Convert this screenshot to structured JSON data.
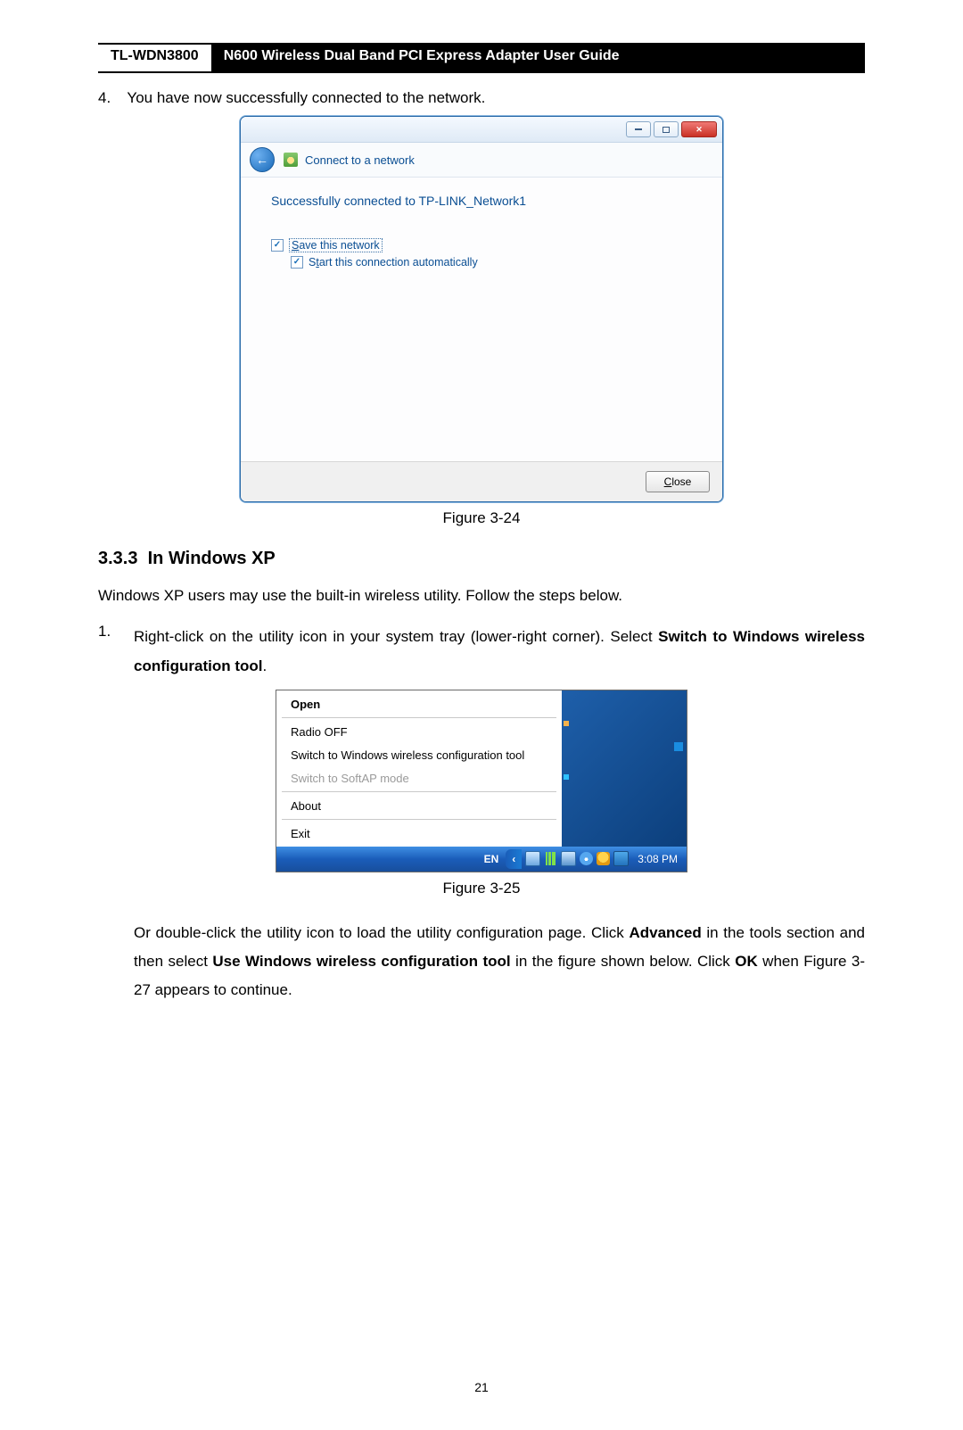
{
  "header": {
    "model": "TL-WDN3800",
    "title": "N600 Wireless Dual Band PCI Express Adapter User Guide"
  },
  "step4": {
    "num": "4.",
    "text": "You have now successfully connected to the network."
  },
  "vista": {
    "nav_title": "Connect to a network",
    "message": "Successfully connected to TP-LINK_Network1",
    "save_prefix_ul": "S",
    "save_rest": "ave this network",
    "auto_prefix": "S",
    "auto_ul": "t",
    "auto_rest": "art this connection automatically",
    "close_ul": "C",
    "close_rest": "lose"
  },
  "fig24": "Figure 3-24",
  "section": {
    "num": "3.3.3",
    "title": "In Windows XP"
  },
  "xp_intro": "Windows XP users may use the built-in wireless utility. Follow the steps below.",
  "step1": {
    "num": "1.",
    "pre": "Right-click on the utility icon in your system tray (lower-right corner). Select ",
    "bold": "Switch to Windows wireless configuration tool",
    "post": "."
  },
  "xpmenu": {
    "open": "Open",
    "radio": "Radio OFF",
    "switch": "Switch to Windows wireless configuration tool",
    "softap": "Switch to SoftAP mode",
    "about": "About",
    "exit": "Exit",
    "lang": "EN",
    "clock": "3:08 PM"
  },
  "fig25": "Figure 3-25",
  "after": {
    "t1": "Or double-click the utility icon to load the utility configuration page. Click ",
    "b1": "Advanced",
    "t2": " in the tools section and then select ",
    "b2": "Use Windows wireless configuration tool",
    "t3": " in the figure shown below. Click ",
    "b3": "OK",
    "t4": " when Figure 3-27 appears to continue."
  },
  "pagenum": "21"
}
